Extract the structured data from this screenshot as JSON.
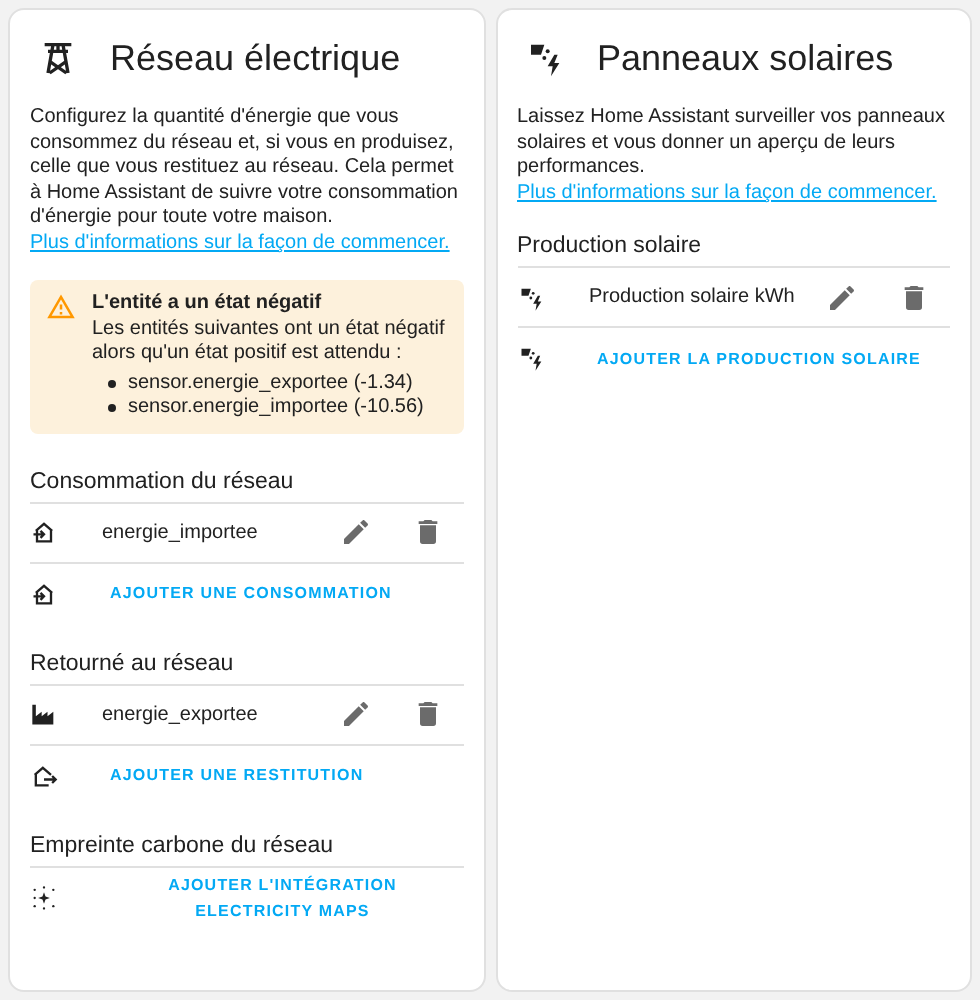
{
  "cards": [
    {
      "kind": "grid",
      "title": "Réseau électrique",
      "description": "Configurez la quantité d'énergie que vous consommez du réseau et, si vous en produisez, celle que vous restituez au réseau. Cela permet à Home Assistant de suivre votre consommation d'énergie pour toute votre maison.",
      "link": "Plus d'informations sur la façon de commencer.",
      "warning": {
        "title": "L'entité a un état négatif",
        "text": "Les entités suivantes ont un état négatif alors qu'un état positif est attendu :",
        "items": [
          "sensor.energie_exportee (-1.34)",
          "sensor.energie_importee (-10.56)"
        ]
      },
      "sections": [
        {
          "title": "Consommation du réseau",
          "items": [
            {
              "kind": "import",
              "label": "energie_importee"
            }
          ],
          "add": {
            "kind": "import",
            "label": "AJOUTER UNE CONSOMMATION"
          }
        },
        {
          "title": "Retourné au réseau",
          "items": [
            {
              "kind": "export",
              "label": "energie_exportee"
            }
          ],
          "add": {
            "kind": "return",
            "label": "AJOUTER UNE RESTITUTION"
          }
        },
        {
          "title": "Empreinte carbone du réseau",
          "add": {
            "kind": "carbon",
            "label": "AJOUTER L'INTÉGRATION ELECTRICITY MAPS"
          }
        }
      ]
    },
    {
      "kind": "solar",
      "title": "Panneaux solaires",
      "description": "Laissez Home Assistant surveiller vos panneaux solaires et vous donner un aperçu de leurs performances.",
      "link": "Plus d'informations sur la façon de commencer.",
      "sections": [
        {
          "title": "Production solaire",
          "items": [
            {
              "kind": "solar",
              "label": "Production solaire kWh"
            }
          ],
          "add": {
            "kind": "solar",
            "label": "AJOUTER LA PRODUCTION SOLAIRE"
          }
        }
      ]
    }
  ]
}
